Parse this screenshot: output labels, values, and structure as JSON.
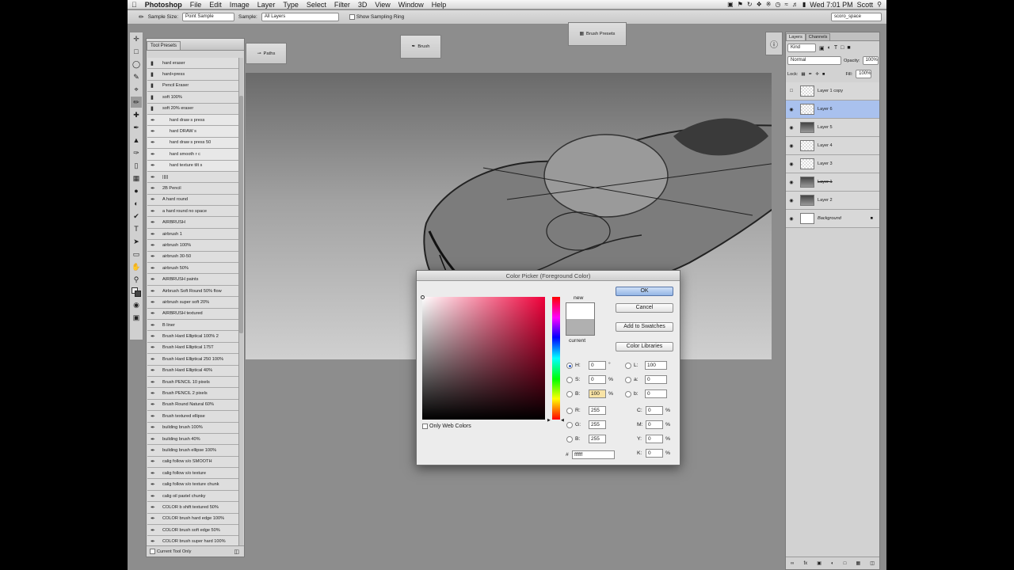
{
  "menubar": {
    "app": "Photoshop",
    "items": [
      "File",
      "Edit",
      "Image",
      "Layer",
      "Type",
      "Select",
      "Filter",
      "3D",
      "View",
      "Window",
      "Help"
    ],
    "time": "Wed 7:01 PM",
    "user": "Scott"
  },
  "options": {
    "sample_size_label": "Sample Size:",
    "sample_size_value": "Point Sample",
    "sample_label": "Sample:",
    "sample_value": "All Layers",
    "ring_label": "Show Sampling Ring",
    "workspace": "scoro_space"
  },
  "panels": {
    "paths": "Paths",
    "brush": "Brush",
    "brush_presets": "Brush Presets"
  },
  "tool_presets": {
    "tab": "Tool Presets",
    "items": [
      "hard eraser",
      "hard+press",
      "Pencil Eraser",
      "soft 100%",
      "soft 20% eraser",
      "hard draw s press",
      "hard DRAW s",
      "hard draw s press 50",
      "hard smooth r c",
      "hard texture tilt s",
      "|||||",
      "2B Pencil",
      "A hard round",
      "a hard round no space",
      "AIRBRUSH",
      "airbrush 1",
      "airbrush 100%",
      "airbrush 30-50",
      "airbrush 50%",
      "AIRBRUSH paints",
      "Airbrush Soft Round 50% flow",
      "airbrush super soft 20%",
      "AIRBRUSH textured",
      "B liner",
      "Brush Hard Elliptical 100% 2",
      "Brush Hard Elliptical 175T",
      "Brush Hard Elliptical 250 100%",
      "Brush Hard Elliptical 40%",
      "Brush PENCIL 10 pixels",
      "Brush PENCIL 2 pixels",
      "Brush Round Natural 60%",
      "Brush textured ellipse",
      "building brush 100%",
      "building brush 40%",
      "building brush ellipse 100%",
      "calig follow s/o SMOOTH",
      "calig follow s/o texture",
      "calig follow s/o texture chunk",
      "calig oil pastel chunky",
      "COLOR b shift textured 50%",
      "COLOR brush hard edge 100%",
      "COLOR brush soft edge 50%",
      "COLOR brush super hard 100%"
    ],
    "footer": "Current Tool Only"
  },
  "layers": {
    "tabs": [
      "Layers",
      "Channels"
    ],
    "kind": "Kind",
    "blend": "Normal",
    "opacity_label": "Opacity:",
    "opacity": "100%",
    "lock_label": "Lock:",
    "fill_label": "Fill:",
    "fill": "100%",
    "items": [
      "Layer 1 copy",
      "Layer 6",
      "Layer 5",
      "Layer 4",
      "Layer 3",
      "Layer 1",
      "Layer 2",
      "Background"
    ]
  },
  "dialog": {
    "title": "Color Picker (Foreground Color)",
    "ok": "OK",
    "cancel": "Cancel",
    "add_swatches": "Add to Swatches",
    "color_libraries": "Color Libraries",
    "new_label": "new",
    "current_label": "current",
    "web_only": "Only Web Colors",
    "h": "0",
    "s": "0",
    "b": "100",
    "r": "255",
    "g": "255",
    "bl": "255",
    "l": "100",
    "a": "0",
    "lab_b": "0",
    "c": "0",
    "m": "0",
    "y": "0",
    "k": "0",
    "hex": "ffffff",
    "deg": "°",
    "pct": "%",
    "hash": "#",
    "field_labels": {
      "H": "H:",
      "S": "S:",
      "B": "B:",
      "R": "R:",
      "G": "G:",
      "Bl": "B:",
      "L": "L:",
      "a": "a:",
      "b": "b:",
      "C": "C:",
      "M": "M:",
      "Y": "Y:",
      "K": "K:"
    },
    "new_color": "#ffffff",
    "current_color": "#b0b0b0"
  }
}
